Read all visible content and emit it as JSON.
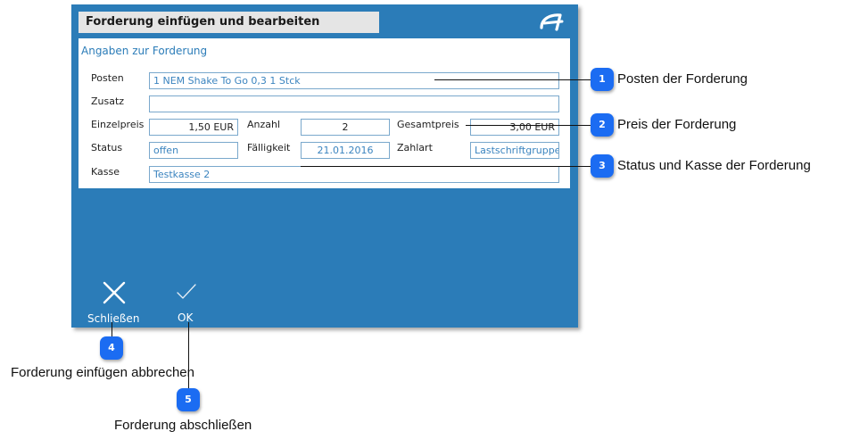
{
  "dialog": {
    "title": "Forderung einfügen und bearbeiten",
    "section_title": "Angaben zur Forderung",
    "fields": {
      "posten": {
        "label": "Posten",
        "value": "1 NEM Shake To Go 0,3 1 Stck"
      },
      "zusatz": {
        "label": "Zusatz",
        "value": ""
      },
      "einzelpreis": {
        "label": "Einzelpreis",
        "value": "1,50 EUR"
      },
      "anzahl": {
        "label": "Anzahl",
        "value": "2"
      },
      "gesamtpreis": {
        "label": "Gesamtpreis",
        "value": "3,00 EUR"
      },
      "status": {
        "label": "Status",
        "value": "offen"
      },
      "faelligkeit": {
        "label": "Fälligkeit",
        "value": "21.01.2016"
      },
      "zahlart": {
        "label": "Zahlart",
        "value": "Lastschriftgruppe"
      },
      "kasse": {
        "label": "Kasse",
        "value": "Testkasse 2"
      }
    },
    "buttons": {
      "close_label": "Schließen",
      "ok_label": "OK"
    }
  },
  "callouts": [
    {
      "number": "1",
      "text": "Posten der Forderung"
    },
    {
      "number": "2",
      "text": "Preis der Forderung"
    },
    {
      "number": "3",
      "text": "Status und Kasse der Forderung"
    },
    {
      "number": "4",
      "text": "Forderung einfügen abbrechen"
    },
    {
      "number": "5",
      "text": "Forderung abschließen"
    }
  ],
  "colors": {
    "dialog_background": "#2b7cb8",
    "title_bar": "#e5e5e5",
    "field_text": "#3b84bf",
    "marker": "#1b6cf2"
  }
}
